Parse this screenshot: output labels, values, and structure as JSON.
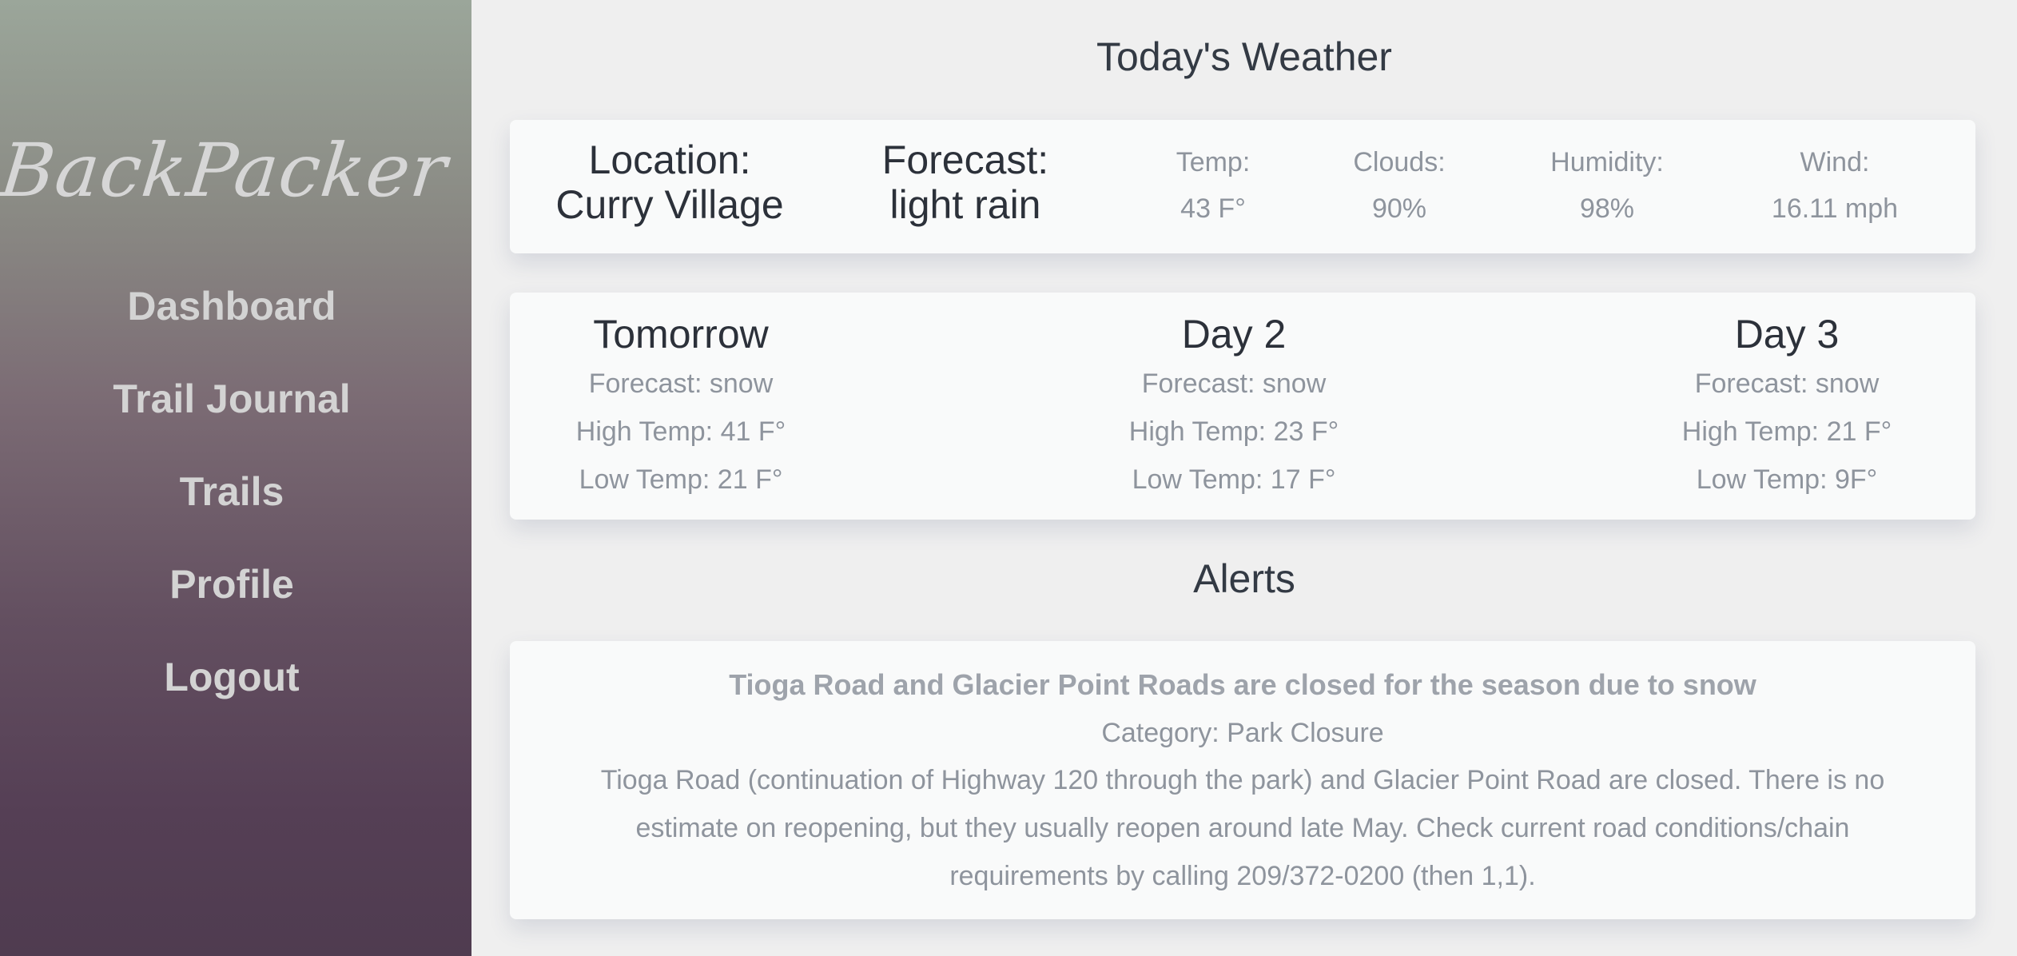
{
  "sidebar": {
    "logo": "BackPacker",
    "items": [
      {
        "label": "Dashboard"
      },
      {
        "label": "Trail Journal"
      },
      {
        "label": "Trails"
      },
      {
        "label": "Profile"
      },
      {
        "label": "Logout"
      }
    ]
  },
  "weather": {
    "title": "Today's Weather",
    "location_label": "Location:",
    "location_value": "Curry Village",
    "forecast_label": "Forecast:",
    "forecast_value": "light rain",
    "temp_label": "Temp:",
    "temp_value": "43 F°",
    "clouds_label": "Clouds:",
    "clouds_value": "90%",
    "humidity_label": "Humidity:",
    "humidity_value": "98%",
    "wind_label": "Wind:",
    "wind_value": "16.11 mph"
  },
  "forecast_days": [
    {
      "title": "Tomorrow",
      "forecast": "Forecast: snow",
      "high": "High Temp: 41 F°",
      "low": "Low Temp: 21 F°"
    },
    {
      "title": "Day 2",
      "forecast": "Forecast: snow",
      "high": "High Temp: 23 F°",
      "low": "Low Temp: 17 F°"
    },
    {
      "title": "Day 3",
      "forecast": "Forecast: snow",
      "high": "High Temp: 21 F°",
      "low": "Low Temp: 9F°"
    }
  ],
  "alerts": {
    "title": "Alerts",
    "items": [
      {
        "headline": "Tioga Road and Glacier Point Roads are closed for the season due to snow",
        "category": "Category: Park Closure",
        "description": "Tioga Road (continuation of Highway 120 through the park) and Glacier Point Road are closed. There is no estimate on reopening, but they usually reopen around late May. Check current road conditions/chain requirements by calling 209/372-0200 (then 1,1)."
      }
    ]
  }
}
